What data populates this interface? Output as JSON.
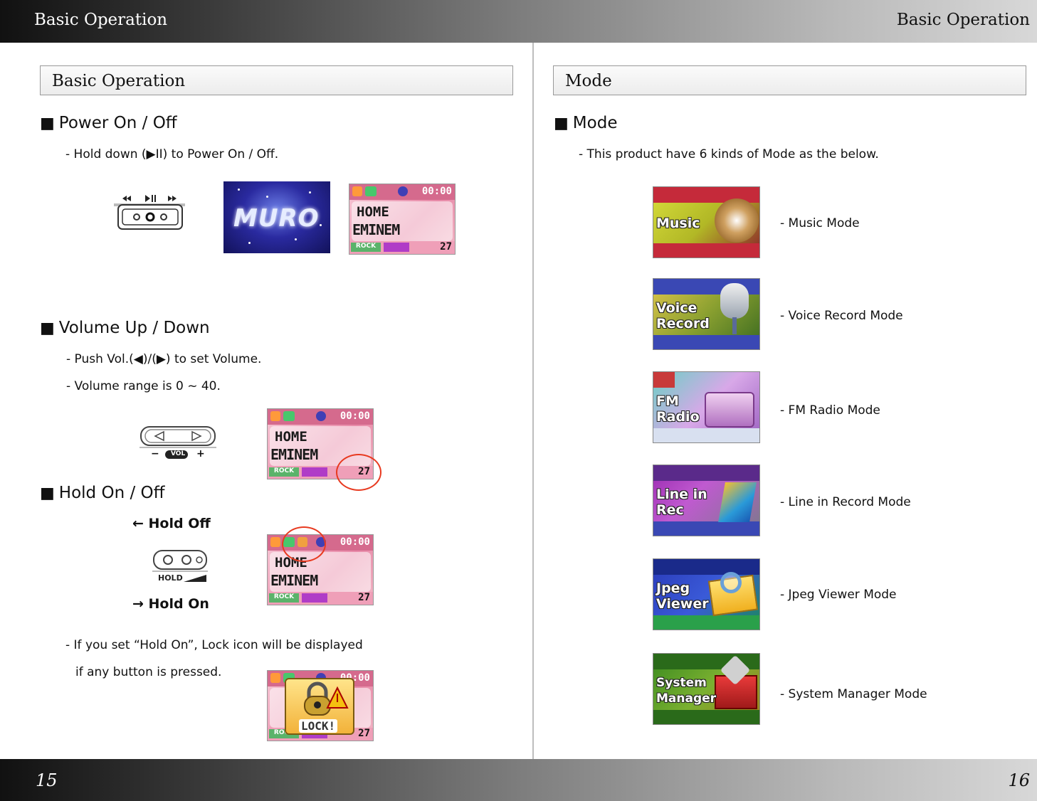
{
  "header": {
    "left_title": "Basic Operation",
    "right_title": "Basic Operation"
  },
  "footer": {
    "left_page": "15",
    "right_page": "16"
  },
  "left": {
    "box_title": "Basic Operation",
    "power": {
      "heading": "Power On / Off",
      "line1": "- Hold down (▶II) to Power On / Off.",
      "splash_word": "MURO"
    },
    "volume": {
      "heading": "Volume Up / Down",
      "line1": "- Push Vol.(◀)/(▶) to set Volume.",
      "line2": "- Volume range is 0 ~ 40.",
      "vol_label": "VOL",
      "minus": "−",
      "plus": "+"
    },
    "hold": {
      "heading": "Hold On / Off",
      "hold_off": "← Hold Off",
      "hold_on": "→ Hold On",
      "hold_label": "HOLD",
      "note1": "- If you set “Hold On”, Lock icon will be displayed",
      "note2": "if any button is pressed.",
      "lock_text": "LOCK!"
    },
    "screen": {
      "clock": "00:00",
      "folder": "HOME",
      "artist": "EMINEM",
      "eq": "ROCK",
      "volume": "27"
    }
  },
  "right": {
    "box_title": "Mode",
    "heading": "Mode",
    "intro": "- This product have 6 kinds of Mode as the below.",
    "modes": [
      {
        "image_text": "Music",
        "label": "- Music Mode"
      },
      {
        "image_text": "Voice Record",
        "label": "- Voice Record Mode"
      },
      {
        "image_text": "FM Radio",
        "label": "- FM Radio Mode"
      },
      {
        "image_text": "Line in Rec",
        "label": "- Line in Record Mode"
      },
      {
        "image_text": "Jpeg Viewer",
        "label": "- Jpeg Viewer Mode"
      },
      {
        "image_text": "System Manager",
        "label": "- System Manager Mode"
      }
    ]
  },
  "icons": {
    "square_bullet": "■",
    "play_pause": "▶II",
    "rewind": "◀◀",
    "forward": "▶▶"
  }
}
